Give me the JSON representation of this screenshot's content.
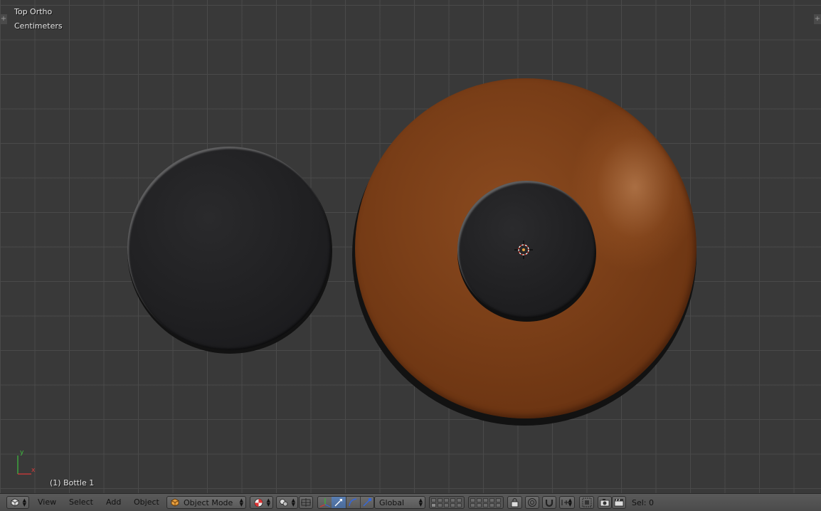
{
  "viewport": {
    "view_name": "Top Ortho",
    "units": "Centimeters",
    "active_object": "(1) Bottle 1",
    "axis_labels": {
      "y": "y",
      "x": "x"
    }
  },
  "scene": {
    "colors": {
      "background": "#393939",
      "bottle": "#7b3f18",
      "cap": "#1f1f21"
    }
  },
  "header": {
    "editor_type_icon": "cube-view-icon",
    "menus": [
      "View",
      "Select",
      "Add",
      "Object"
    ],
    "mode": {
      "label": "Object Mode",
      "icon": "object-mode-icon"
    },
    "viewport_shading_icon": "shading-sphere-icon",
    "pivot_icon": "pivot-point-icon",
    "transform_orientation": "Global",
    "selection_info": "Sel: 0"
  }
}
